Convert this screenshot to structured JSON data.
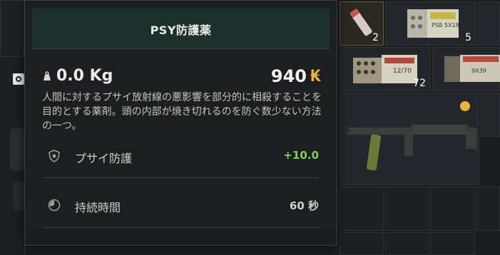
{
  "tooltip": {
    "title": "PSY防護薬",
    "weight": "0.0 Kg",
    "price": "940",
    "currency_symbol": "₭",
    "description": "人間に対するプサイ放射線の悪影響を部分的に相殺することを目的とする薬剤。頭の内部が焼き切れるのを防ぐ数少ない方法の一つ。",
    "stats": [
      {
        "label": "プサイ防護",
        "value": "+10.0",
        "color": "#7ccf5a",
        "icon": "psy-shield-icon"
      },
      {
        "label": "持続時間",
        "value": "60 秒",
        "color": "#cfd1cd",
        "icon": "clock-icon"
      }
    ]
  },
  "inventory": {
    "slots": [
      {
        "name": "smoke-grenade",
        "count": "2"
      },
      {
        "name": "ammo-box-5x18",
        "count": "5",
        "label": "PSB 5X18"
      },
      {
        "name": "ammo-box-12x70",
        "count": "72",
        "label": "12/70"
      },
      {
        "name": "ammo-box-9x39",
        "label": "9X39"
      }
    ]
  },
  "colors": {
    "accent_gold": "#e8b43a",
    "positive_green": "#7ccf5a",
    "header_green": "#1d302b"
  }
}
